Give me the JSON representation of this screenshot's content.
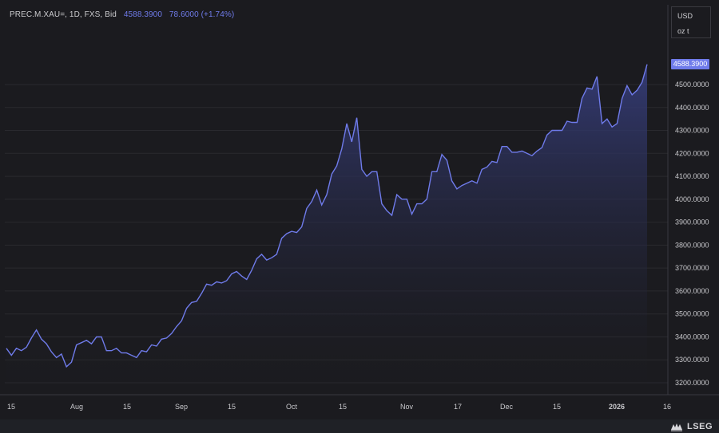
{
  "legend": {
    "symbol": "PREC.M.XAU=, 1D, FXS, Bid",
    "last": "4588.3900",
    "change": "78.6000 (+1.74%)"
  },
  "unit_box": {
    "currency": "USD",
    "unit": "oz t"
  },
  "last_price_label": "4588.3900",
  "brand": {
    "name": "LSEG",
    "logo_icon": "lseg-logo-icon"
  },
  "colors": {
    "background": "#1b1b1f",
    "line": "#6f7bea",
    "area_top": "#2f3569",
    "grid": "#2a2a2f",
    "axis_text": "#c8c8cc"
  },
  "chart_data": {
    "type": "area",
    "title": "",
    "xlabel": "",
    "ylabel": "",
    "ylim": [
      3150,
      4700
    ],
    "grid": true,
    "y_ticks": [
      "3200.0000",
      "3300.0000",
      "3400.0000",
      "3500.0000",
      "3600.0000",
      "3700.0000",
      "3800.0000",
      "3900.0000",
      "4000.0000",
      "4100.0000",
      "4200.0000",
      "4300.0000",
      "4400.0000",
      "4500.0000"
    ],
    "x_ticks": [
      "15",
      "Aug",
      "15",
      "Sep",
      "15",
      "Oct",
      "15",
      "Nov",
      "17",
      "Dec",
      "15",
      "2026",
      "16"
    ],
    "series": [
      {
        "name": "",
        "values": [
          3350,
          3320,
          3350,
          3340,
          3355,
          3395,
          3430,
          3390,
          3370,
          3335,
          3310,
          3325,
          3270,
          3290,
          3365,
          3375,
          3385,
          3370,
          3400,
          3400,
          3340,
          3340,
          3350,
          3330,
          3330,
          3320,
          3310,
          3340,
          3335,
          3365,
          3360,
          3390,
          3395,
          3415,
          3445,
          3470,
          3525,
          3550,
          3555,
          3590,
          3630,
          3625,
          3640,
          3635,
          3645,
          3675,
          3685,
          3665,
          3650,
          3690,
          3740,
          3760,
          3735,
          3745,
          3760,
          3830,
          3850,
          3860,
          3855,
          3880,
          3960,
          3990,
          4040,
          3975,
          4020,
          4110,
          4145,
          4220,
          4330,
          4250,
          4355,
          4130,
          4100,
          4120,
          4120,
          3980,
          3950,
          3930,
          4020,
          4000,
          4000,
          3935,
          3980,
          3980,
          4000,
          4120,
          4120,
          4195,
          4170,
          4080,
          4045,
          4060,
          4070,
          4080,
          4070,
          4130,
          4140,
          4165,
          4160,
          4230,
          4230,
          4205,
          4205,
          4210,
          4200,
          4190,
          4210,
          4225,
          4280,
          4300,
          4300,
          4300,
          4340,
          4335,
          4335,
          4440,
          4485,
          4480,
          4535,
          4330,
          4350,
          4315,
          4330,
          4440,
          4495,
          4455,
          4475,
          4510,
          4588
        ]
      }
    ]
  }
}
